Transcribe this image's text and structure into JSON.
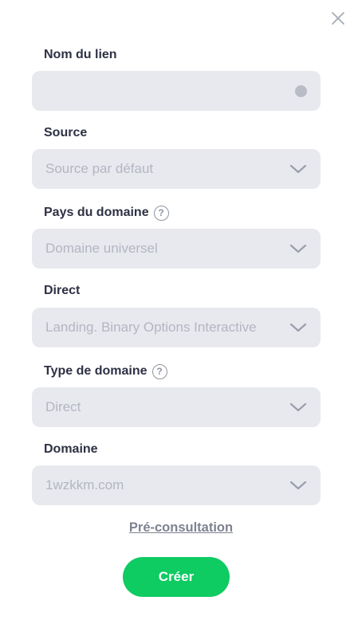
{
  "icons": {
    "close": "close-icon",
    "chevron": "chevron-down-icon",
    "help": "help-circle-icon"
  },
  "colors": {
    "accent": "#0ecb62",
    "field_bg": "#e8e9ee",
    "label": "#2e3144",
    "placeholder": "#b3b6c2"
  },
  "form": {
    "link_name": {
      "label": "Nom du lien",
      "value": ""
    },
    "source": {
      "label": "Source",
      "value": "Source par défaut"
    },
    "domain_country": {
      "label": "Pays du domaine",
      "help": "?",
      "value": "Domaine universel"
    },
    "direct": {
      "label": "Direct",
      "value": "Landing. Binary Options Interactive"
    },
    "domain_type": {
      "label": "Type de domaine",
      "help": "?",
      "value": "Direct"
    },
    "domain": {
      "label": "Domaine",
      "value": "1wzkkm.com"
    }
  },
  "actions": {
    "preview": "Pré-consultation",
    "create": "Créer"
  }
}
